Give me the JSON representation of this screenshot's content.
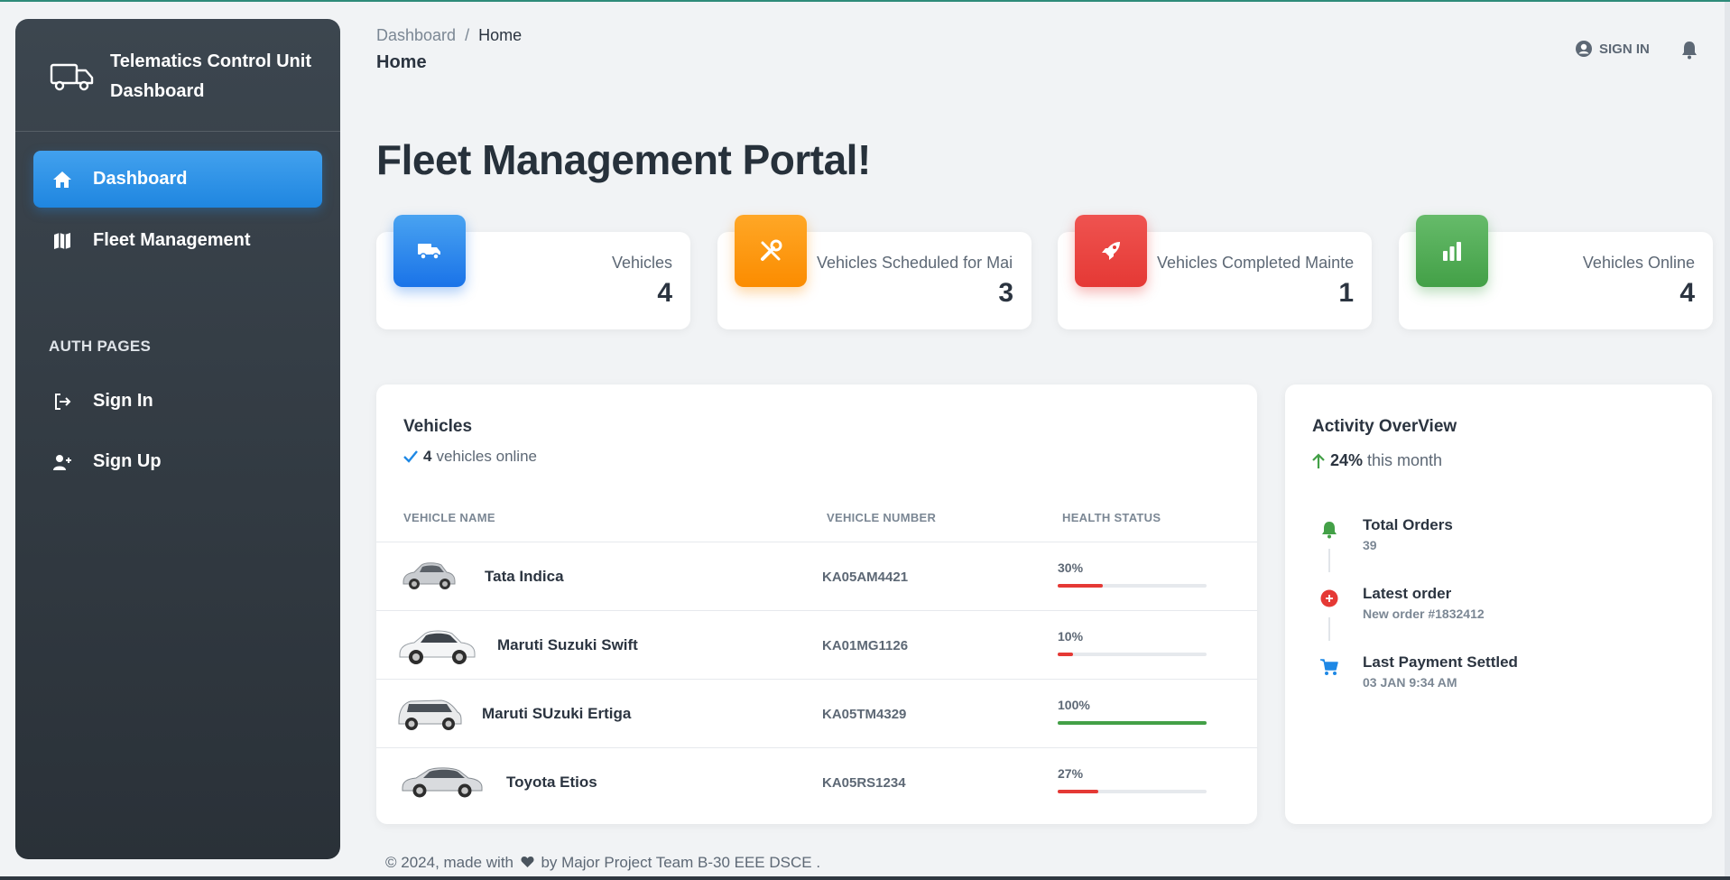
{
  "sidebar": {
    "brand_title": "Telematics Control Unit Dashboard",
    "nav": [
      {
        "label": "Dashboard",
        "icon": "home-icon",
        "active": true
      },
      {
        "label": "Fleet Management",
        "icon": "map-icon",
        "active": false
      }
    ],
    "section_label": "AUTH PAGES",
    "auth": [
      {
        "label": "Sign In",
        "icon": "sign-in-icon"
      },
      {
        "label": "Sign Up",
        "icon": "add-user-icon"
      }
    ]
  },
  "header": {
    "breadcrumb_root": "Dashboard",
    "breadcrumb_sep": "/",
    "breadcrumb_current": "Home",
    "title": "Home",
    "signin_label": "SIGN IN"
  },
  "page_title": "Fleet Management Portal!",
  "stats": [
    {
      "label": "Vehicles",
      "value": "4",
      "icon": "truck-icon",
      "color": "#1e88e5"
    },
    {
      "label": "Vehicles Scheduled for Maintenance",
      "value": "3",
      "icon": "tools-icon",
      "color": "#fb8c00"
    },
    {
      "label": "Vehicles Completed Maintenance",
      "value": "1",
      "icon": "rocket-icon",
      "color": "#e53935"
    },
    {
      "label": "Vehicles Online",
      "value": "4",
      "icon": "bar-chart-icon",
      "color": "#43a047"
    }
  ],
  "vehicles_panel": {
    "title": "Vehicles",
    "online_count": "4",
    "online_text": "vehicles online",
    "columns": [
      "VEHICLE NAME",
      "VEHICLE NUMBER",
      "HEALTH STATUS"
    ],
    "rows": [
      {
        "name": "Tata Indica",
        "number": "KA05AM4421",
        "health": "30%",
        "progress": 0.3,
        "bar_color": "#e53935"
      },
      {
        "name": "Maruti Suzuki Swift",
        "number": "KA01MG1126",
        "health": "10%",
        "progress": 0.1,
        "bar_color": "#e53935"
      },
      {
        "name": "Maruti SUzuki Ertiga",
        "number": "KA05TM4329",
        "health": "100%",
        "progress": 1.0,
        "bar_color": "#43a047"
      },
      {
        "name": "Toyota Etios",
        "number": "KA05RS1234",
        "health": "27%",
        "progress": 0.27,
        "bar_color": "#e53935"
      }
    ]
  },
  "activity_panel": {
    "title": "Activity OverView",
    "growth": "24%",
    "growth_text": "this month",
    "items": [
      {
        "title": "Total Orders",
        "sub": "39",
        "icon": "bell-icon",
        "color": "#43a047"
      },
      {
        "title": "Latest order",
        "sub": "New order #1832412",
        "icon": "plus-circle-icon",
        "color": "#e53935"
      },
      {
        "title": "Last Payment Settled",
        "sub": "03 JAN 9:34 AM",
        "icon": "cart-icon",
        "color": "#1e88e5"
      }
    ]
  },
  "footer": {
    "prefix": "© 2024, made with",
    "suffix": "by Major Project Team B-30 EEE DSCE ."
  }
}
